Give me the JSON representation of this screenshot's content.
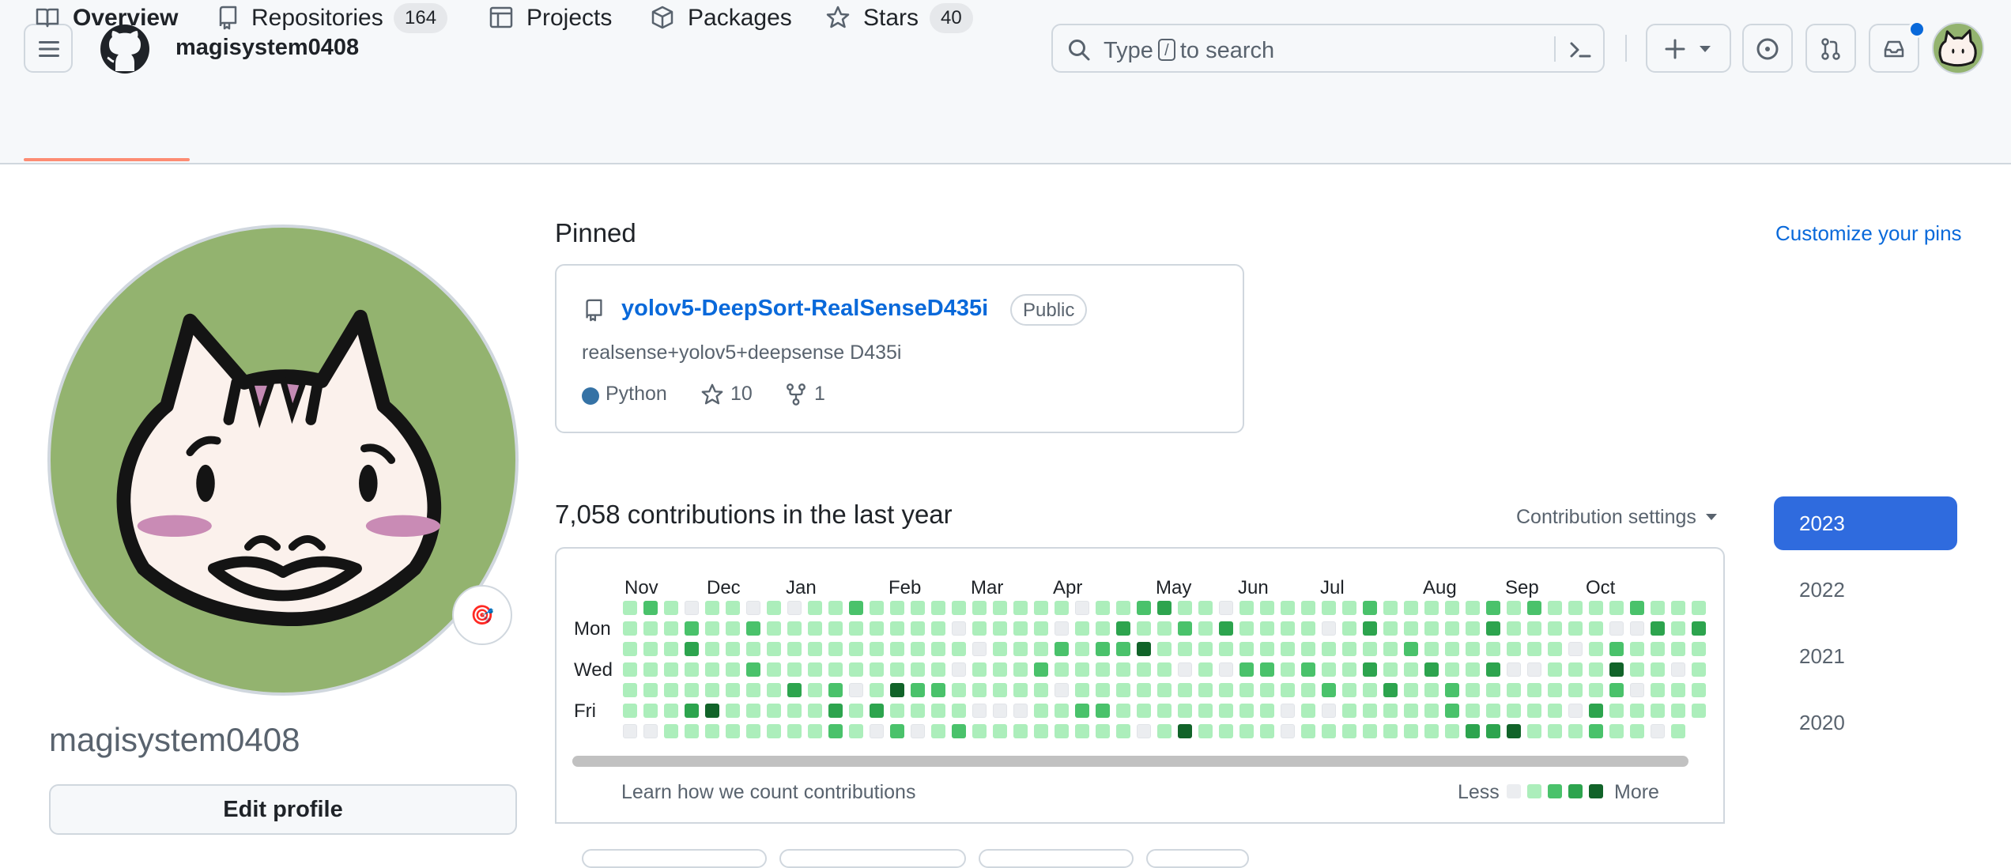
{
  "header": {
    "username": "magisystem0408",
    "search_prefix": "Type",
    "search_key": "/",
    "search_suffix": "to search"
  },
  "tabs": [
    {
      "label": "Overview"
    },
    {
      "label": "Repositories",
      "count": "164"
    },
    {
      "label": "Projects"
    },
    {
      "label": "Packages"
    },
    {
      "label": "Stars",
      "count": "40"
    }
  ],
  "profile": {
    "name": "magisystem0408",
    "edit_label": "Edit profile",
    "status_emoji": "🎯"
  },
  "pinned": {
    "title": "Pinned",
    "customize_label": "Customize your pins",
    "repo": {
      "name": "yolov5-DeepSort-RealSenseD435i",
      "visibility": "Public",
      "description": "realsense+yolov5+deepsense D435i",
      "language": "Python",
      "language_color": "#3572A5",
      "stars": "10",
      "forks": "1"
    }
  },
  "contributions": {
    "title": "7,058 contributions in the last year",
    "settings_label": "Contribution settings",
    "months": [
      "Nov",
      "Dec",
      "Jan",
      "Feb",
      "Mar",
      "Apr",
      "May",
      "Jun",
      "Jul",
      "Aug",
      "Sep",
      "Oct"
    ],
    "days": [
      "Mon",
      "Wed",
      "Fri"
    ],
    "learn_label": "Learn how we count contributions",
    "less_label": "Less",
    "more_label": "More",
    "colors": [
      "#ebedf0",
      "#aceebb",
      "#4ac26b",
      "#2da44e",
      "#116329"
    ]
  },
  "years": [
    "2023",
    "2022",
    "2021",
    "2020"
  ],
  "colors": {
    "accent": "#0969da",
    "tab_underline": "#fd8c73",
    "avatar_bg": "#93b36f",
    "year_active": "#2f6bde"
  }
}
